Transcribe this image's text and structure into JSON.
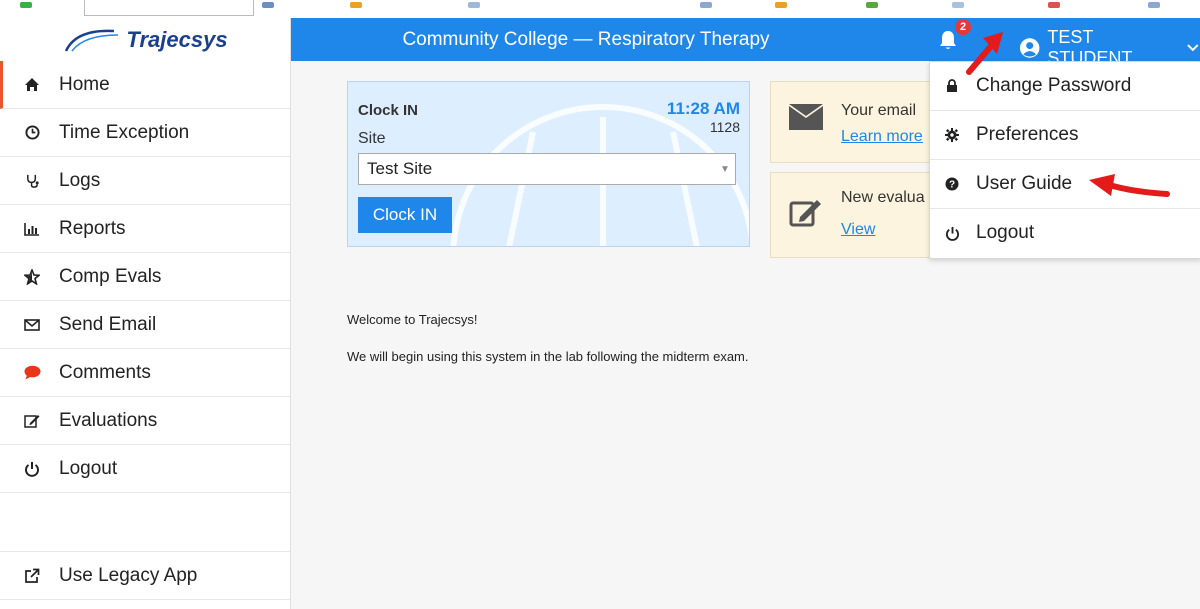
{
  "header": {
    "brand": "Trajecsys",
    "title": "Community College — Respiratory Therapy",
    "notification_count": "2",
    "user_name": "TEST STUDENT"
  },
  "sidebar": {
    "items": [
      {
        "label": "Home",
        "icon": "home-icon"
      },
      {
        "label": "Time Exception",
        "icon": "clock-icon"
      },
      {
        "label": "Logs",
        "icon": "stethoscope-icon"
      },
      {
        "label": "Reports",
        "icon": "bar-chart-icon"
      },
      {
        "label": "Comp Evals",
        "icon": "star-icon"
      },
      {
        "label": "Send Email",
        "icon": "envelope-icon"
      },
      {
        "label": "Comments",
        "icon": "comment-icon"
      },
      {
        "label": "Evaluations",
        "icon": "edit-icon"
      },
      {
        "label": "Logout",
        "icon": "power-icon"
      }
    ],
    "legacy": {
      "label": "Use Legacy App",
      "icon": "external-link-icon"
    }
  },
  "clock": {
    "label": "Clock IN",
    "time": "11:28 AM",
    "time_number": "1128",
    "site_label": "Site",
    "site_value": "Test Site",
    "button": "Clock IN"
  },
  "notices": [
    {
      "text": "Your email",
      "link": "Learn more",
      "icon": "envelope-icon"
    },
    {
      "text": "New evalua",
      "link": "View",
      "icon": "edit-icon"
    }
  ],
  "user_menu": {
    "items": [
      {
        "label": "Change Password",
        "icon": "lock-icon"
      },
      {
        "label": "Preferences",
        "icon": "gear-icon"
      },
      {
        "label": "User Guide",
        "icon": "question-circle-icon"
      },
      {
        "label": "Logout",
        "icon": "power-icon"
      }
    ]
  },
  "main": {
    "welcome": "Welcome to Trajecsys!",
    "message": "We will begin using this system in the lab following the midterm exam."
  },
  "colors": {
    "accent": "#1e87e9",
    "active_marker": "#e8562a",
    "annotation_arrow": "#e31b1b",
    "badge": "#e53935"
  }
}
